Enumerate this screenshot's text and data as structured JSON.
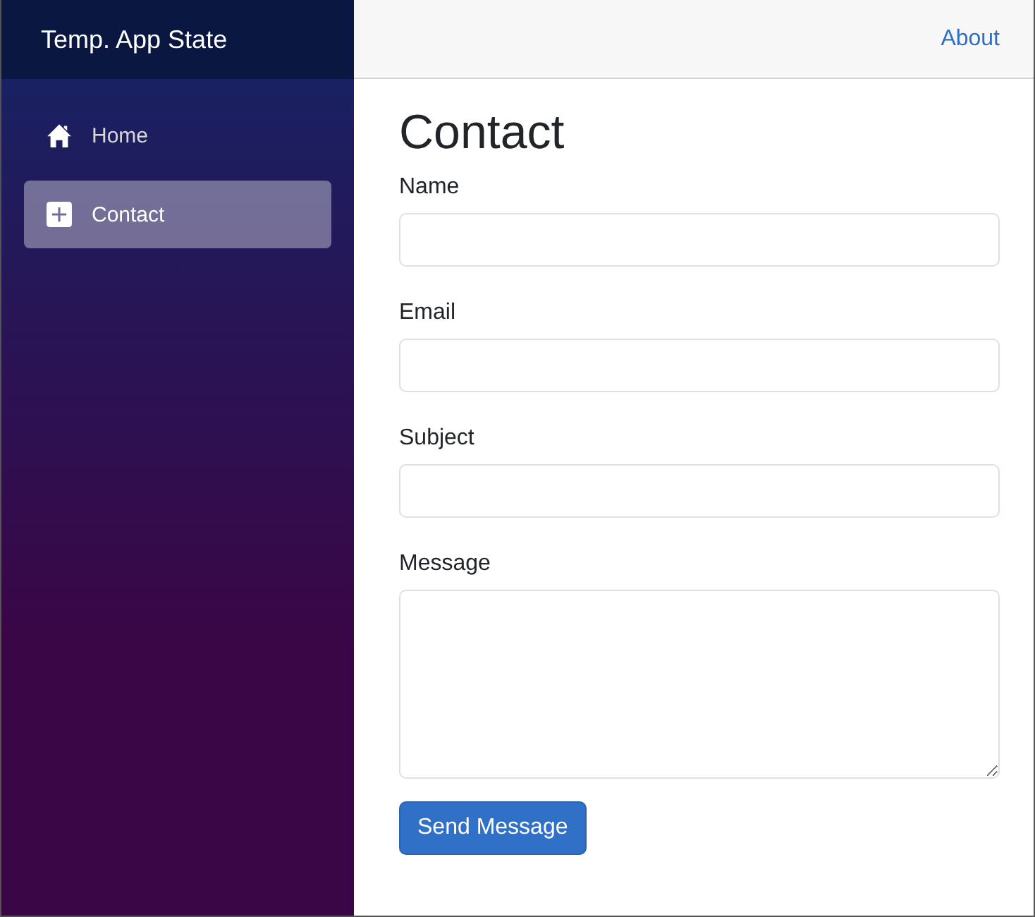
{
  "brand": "Temp. App State",
  "nav": [
    {
      "label": "Home",
      "kind": "home",
      "selected": false
    },
    {
      "label": "Contact",
      "kind": "add",
      "selected": true
    }
  ],
  "top_bar": {
    "link": "About"
  },
  "page_title": "Contact",
  "fields": [
    {
      "label": "Name",
      "kind": "input"
    },
    {
      "label": "Email",
      "kind": "input"
    },
    {
      "label": "Subject",
      "kind": "input"
    },
    {
      "label": "Message",
      "kind": "textarea"
    }
  ],
  "submit": "Send Message"
}
